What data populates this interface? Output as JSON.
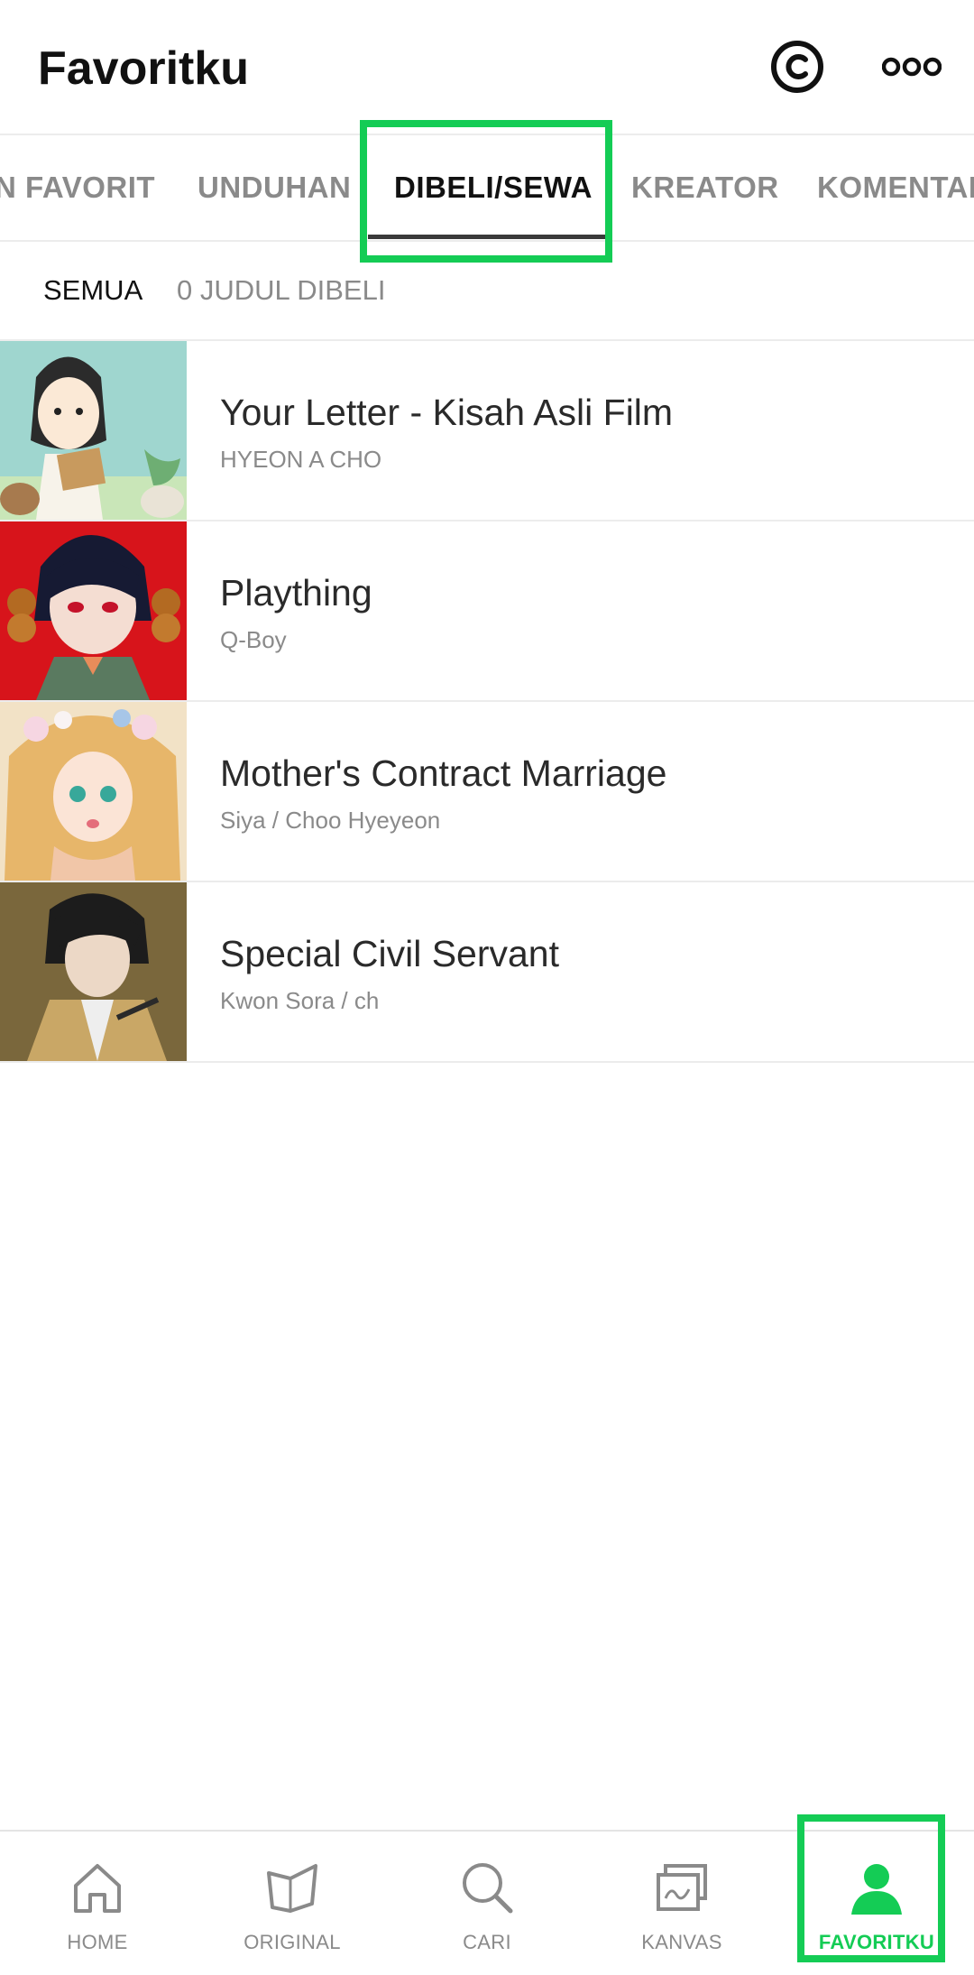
{
  "header": {
    "title": "Favoritku",
    "icons": [
      "copyright-coin-icon",
      "more-options-icon"
    ]
  },
  "tabs": [
    {
      "label": "N FAVORIT",
      "active": false
    },
    {
      "label": "UNDUHAN",
      "active": false
    },
    {
      "label": "DIBELI/SEWA",
      "active": true
    },
    {
      "label": "KREATOR",
      "active": false
    },
    {
      "label": "KOMENTAR",
      "active": false
    }
  ],
  "filter": {
    "all_label": "SEMUA",
    "count_label": "0 JUDUL DIBELI"
  },
  "items": [
    {
      "title": "Your Letter - Kisah Asli Film",
      "author": "HYEON A CHO"
    },
    {
      "title": "Plaything",
      "author": "Q-Boy"
    },
    {
      "title": "Mother's Contract Marriage",
      "author": "Siya / Choo Hyeyeon"
    },
    {
      "title": "Special Civil Servant",
      "author": "Kwon Sora / ch"
    }
  ],
  "bottom_nav": [
    {
      "label": "HOME",
      "icon": "home-icon",
      "active": false
    },
    {
      "label": "ORIGINAL",
      "icon": "original-book-icon",
      "active": false
    },
    {
      "label": "CARI",
      "icon": "search-icon",
      "active": false
    },
    {
      "label": "KANVAS",
      "icon": "canvas-icon",
      "active": false
    },
    {
      "label": "FAVORITKU",
      "icon": "profile-icon",
      "active": true
    }
  ],
  "colors": {
    "accent": "#14cc55",
    "active_text": "#111111",
    "inactive_text": "#8a8a8a",
    "divider": "#ececec"
  }
}
